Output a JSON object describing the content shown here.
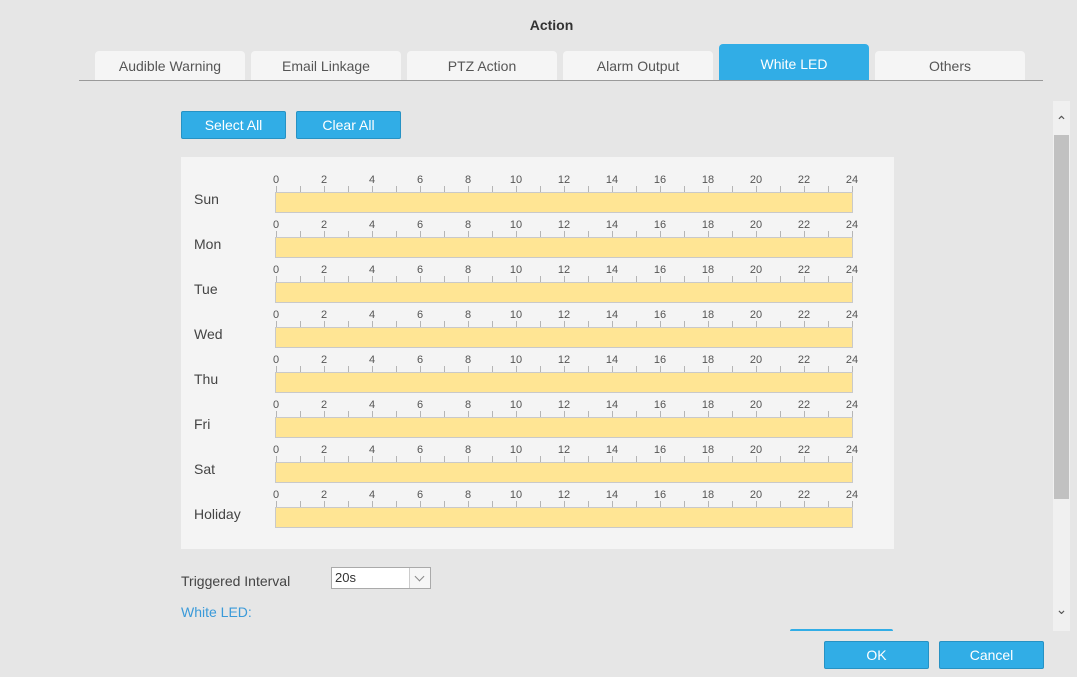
{
  "dialog": {
    "title": "Action"
  },
  "tabs": [
    {
      "label": "Audible Warning",
      "active": false
    },
    {
      "label": "Email Linkage",
      "active": false
    },
    {
      "label": "PTZ Action",
      "active": false
    },
    {
      "label": "Alarm Output",
      "active": false
    },
    {
      "label": "White LED",
      "active": true
    },
    {
      "label": "Others",
      "active": false
    }
  ],
  "toolbar": {
    "select_all": "Select All",
    "clear_all": "Clear All"
  },
  "schedule": {
    "tick_labels": [
      "0",
      "2",
      "4",
      "6",
      "8",
      "10",
      "12",
      "14",
      "16",
      "18",
      "20",
      "22",
      "24"
    ],
    "days": [
      {
        "label": "Sun",
        "selected_fraction": 1
      },
      {
        "label": "Mon",
        "selected_fraction": 1
      },
      {
        "label": "Tue",
        "selected_fraction": 1
      },
      {
        "label": "Wed",
        "selected_fraction": 1
      },
      {
        "label": "Thu",
        "selected_fraction": 1
      },
      {
        "label": "Fri",
        "selected_fraction": 1
      },
      {
        "label": "Sat",
        "selected_fraction": 1
      },
      {
        "label": "Holiday",
        "selected_fraction": 1
      }
    ],
    "selected_color": "#ffe594"
  },
  "triggered_interval": {
    "label": "Triggered Interval",
    "value": "20s"
  },
  "white_led": {
    "heading": "White LED:"
  },
  "footer": {
    "ok": "OK",
    "cancel": "Cancel"
  },
  "colors": {
    "accent": "#31ade6",
    "link": "#3a9ad9"
  }
}
